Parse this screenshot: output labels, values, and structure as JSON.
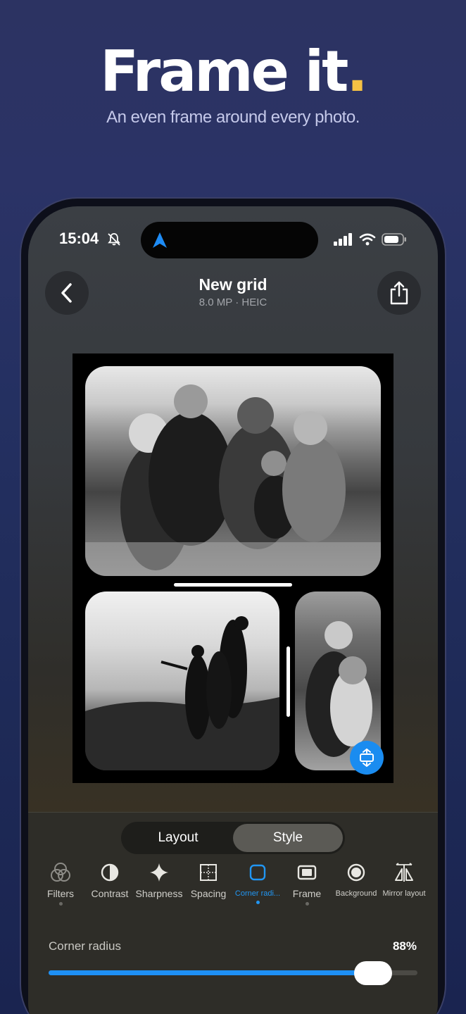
{
  "hero": {
    "title": "Frame it",
    "title_dot": ".",
    "subtitle": "An even frame around every photo."
  },
  "status_bar": {
    "time": "15:04"
  },
  "header": {
    "title": "New grid",
    "meta": "8.0 MP · HEIC"
  },
  "segmented": {
    "items": [
      "Layout",
      "Style"
    ],
    "selected": "Style"
  },
  "tools": [
    {
      "label": "Filters",
      "icon": "filters-icon",
      "dot": true
    },
    {
      "label": "Contrast",
      "icon": "contrast-icon",
      "dot": false
    },
    {
      "label": "Sharpness",
      "icon": "sparkle-icon",
      "dot": false
    },
    {
      "label": "Spacing",
      "icon": "spacing-icon",
      "dot": false
    },
    {
      "label": "Corner radi...",
      "icon": "rounded-square-icon",
      "dot": true,
      "active": true
    },
    {
      "label": "Frame",
      "icon": "frame-icon",
      "dot": true
    },
    {
      "label": "Background",
      "icon": "record-icon",
      "dot": false
    },
    {
      "label": "Mirror layout",
      "icon": "mirror-icon",
      "dot": false
    }
  ],
  "slider": {
    "label": "Corner radius",
    "value_text": "88%",
    "value": 0.88
  },
  "colors": {
    "accent": "#1e90f5",
    "hero_dot": "#f6c244"
  }
}
